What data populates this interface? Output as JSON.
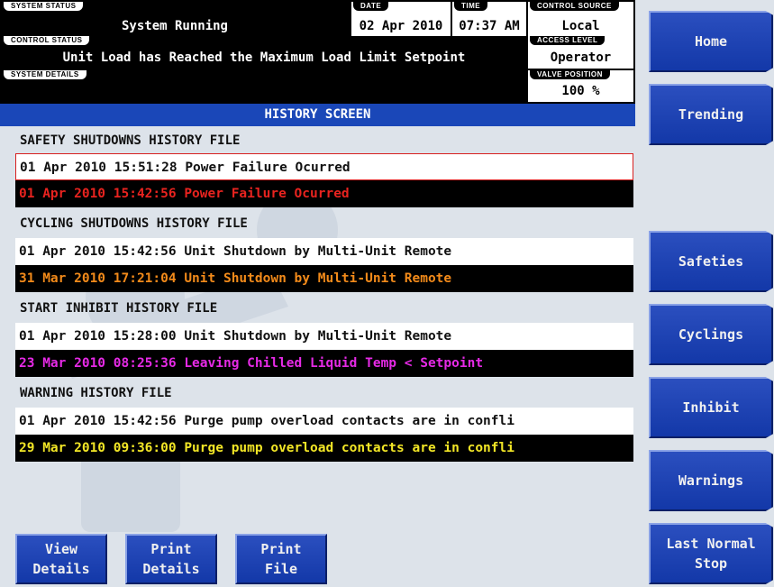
{
  "status_bar": {
    "system_status": {
      "label": "SYSTEM STATUS",
      "value": "System Running"
    },
    "date": {
      "label": "DATE",
      "value": "02 Apr 2010"
    },
    "time": {
      "label": "TIME",
      "value": "07:37 AM"
    },
    "control_source": {
      "label": "CONTROL SOURCE",
      "value": "Local"
    },
    "control_status": {
      "label": "CONTROL STATUS",
      "value": "Unit Load has Reached the Maximum Load Limit Setpoint"
    },
    "access_level": {
      "label": "ACCESS LEVEL",
      "value": "Operator"
    },
    "system_details": {
      "label": "SYSTEM DETAILS",
      "value": ""
    },
    "valve_position": {
      "label": "VALVE POSITION",
      "value": "100 %"
    }
  },
  "screen_title": "HISTORY SCREEN",
  "sections": [
    {
      "header": "SAFETY SHUTDOWNS HISTORY FILE",
      "records": [
        {
          "text": "01 Apr 2010 15:51:28 Power Failure Ocurred",
          "color": "#111111",
          "style": "light",
          "selected": true
        },
        {
          "text": "01 Apr 2010 15:42:56 Power Failure Ocurred",
          "color": "#e8231f",
          "style": "dark"
        }
      ]
    },
    {
      "header": "CYCLING SHUTDOWNS HISTORY FILE",
      "records": [
        {
          "text": "01 Apr 2010 15:42:56 Unit Shutdown by Multi-Unit Remote",
          "color": "#111111",
          "style": "light"
        },
        {
          "text": "31 Mar 2010 17:21:04 Unit Shutdown by Multi-Unit Remote",
          "color": "#f28a1a",
          "style": "dark"
        }
      ]
    },
    {
      "header": "START INHIBIT HISTORY FILE",
      "records": [
        {
          "text": "01 Apr 2010 15:28:00 Unit Shutdown by Multi-Unit Remote",
          "color": "#111111",
          "style": "light"
        },
        {
          "text": "23 Mar 2010 08:25:36 Leaving Chilled Liquid Temp < Setpoint",
          "color": "#e62ae6",
          "style": "dark"
        }
      ]
    },
    {
      "header": "WARNING HISTORY FILE",
      "records": [
        {
          "text": "01 Apr 2010 15:42:56 Purge pump overload contacts are in confli",
          "color": "#111111",
          "style": "light"
        },
        {
          "text": "29 Mar 2010 09:36:00 Purge pump overload contacts are in confli",
          "color": "#f2e626",
          "style": "dark"
        }
      ]
    }
  ],
  "side_nav": [
    "Home",
    "Trending",
    "Safeties",
    "Cyclings",
    "Inhibit",
    "Warnings",
    "Last Normal\nStop"
  ],
  "bottom_buttons": [
    "View\nDetails",
    "Print\nDetails",
    "Print\nFile"
  ],
  "colors": {
    "title_bar": "#1a47b8",
    "button": "#1a3fae",
    "background": "#dde3ea"
  }
}
